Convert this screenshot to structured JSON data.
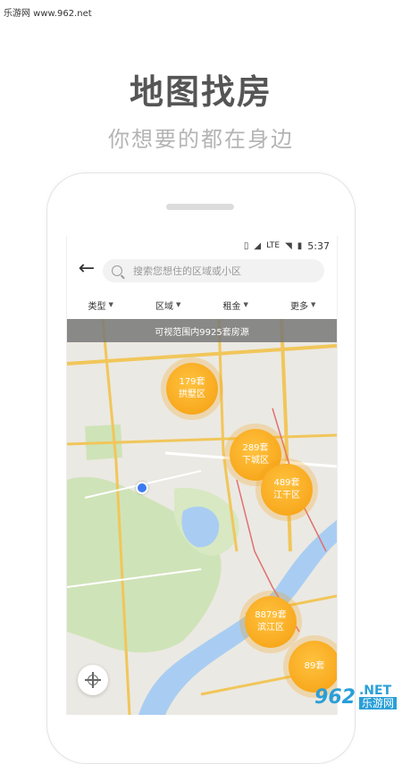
{
  "watermark": {
    "top_text": "乐游网 www.962.net",
    "logo": "962",
    "net": ".NET",
    "cn": "乐游网"
  },
  "hero": {
    "title": "地图找房",
    "subtitle": "你想要的都在身边"
  },
  "status_bar": {
    "time": "5:37",
    "network": "LTE"
  },
  "search": {
    "placeholder": "搜索您想住的区域或小区"
  },
  "filters": [
    {
      "label": "类型"
    },
    {
      "label": "区域"
    },
    {
      "label": "租金"
    },
    {
      "label": "更多"
    }
  ],
  "map": {
    "banner": "可视范围内9925套房源",
    "clusters": [
      {
        "count": "179套",
        "name": "拱墅区"
      },
      {
        "count": "289套",
        "name": "下城区"
      },
      {
        "count": "489套",
        "name": "江干区"
      },
      {
        "count": "8879套",
        "name": "滨江区"
      },
      {
        "count": "89套",
        "name": ""
      }
    ]
  },
  "colors": {
    "accent": "#f59e10",
    "location_dot": "#3a7bf0",
    "water": "#a9cdf2",
    "park": "#cfe3b8"
  }
}
